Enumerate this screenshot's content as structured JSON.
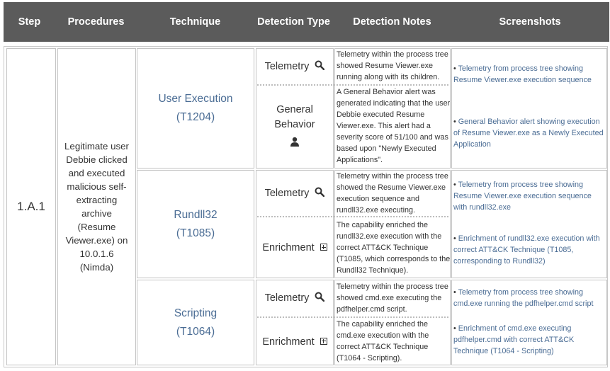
{
  "headers": {
    "step": "Step",
    "procedures": "Procedures",
    "technique": "Technique",
    "detection_type": "Detection Type",
    "detection_notes": "Detection Notes",
    "screenshots": "Screenshots"
  },
  "row": {
    "step": "1.A.1",
    "procedure": "Legitimate user Debbie clicked and executed malicious self-extracting archive (Resume Viewer.exe) on 10.0.1.6 (Nimda)"
  },
  "techniques": [
    {
      "name": "User Execution",
      "id": "(T1204)",
      "detections": [
        {
          "type": "Telemetry",
          "icon": "search-icon",
          "notes": "Telemetry within the process tree showed Resume Viewer.exe running along with its children.",
          "screenshot": "Telemetry from process tree showing Resume Viewer.exe execution sequence"
        },
        {
          "type_line1": "General",
          "type_line2": "Behavior",
          "icon": "user-icon",
          "notes": "A General Behavior alert was generated indicating that the user Debbie executed Resume Viewer.exe. This alert had a severity score of 51/100 and was based upon \"Newly Executed Applications\".",
          "screenshot": "General Behavior alert showing execution of Resume Viewer.exe as a Newly Executed Application"
        }
      ]
    },
    {
      "name": "Rundll32",
      "id": "(T1085)",
      "detections": [
        {
          "type": "Telemetry",
          "icon": "search-icon",
          "notes": "Telemetry within the process tree showed the Resume Viewer.exe execution sequence and rundll32.exe executing.",
          "screenshot": "Telemetry from process tree showing Resume Viewer.exe execution sequence with rundll32.exe"
        },
        {
          "type": "Enrichment",
          "icon": "plus-box-icon",
          "notes": "The capability enriched the rundll32.exe execution with the correct ATT&CK Technique (T1085, which corresponds to the Rundll32 Technique).",
          "screenshot": "Enrichment of rundll32.exe execution with correct ATT&CK Technique (T1085, corresponding to Rundll32)"
        }
      ]
    },
    {
      "name": "Scripting",
      "id": "(T1064)",
      "detections": [
        {
          "type": "Telemetry",
          "icon": "search-icon",
          "notes": "Telemetry within the process tree showed cmd.exe executing the pdfhelper.cmd script.",
          "screenshot": "Telemetry from process tree showing cmd.exe running the pdfhelper.cmd script"
        },
        {
          "type": "Enrichment",
          "icon": "plus-box-icon",
          "notes": "The capability enriched the cmd.exe execution with the correct ATT&CK Technique (T1064 - Scripting).",
          "screenshot": "Enrichment of cmd.exe executing pdfhelper.cmd with correct ATT&CK Technique (T1064 - Scripting)"
        }
      ]
    }
  ]
}
